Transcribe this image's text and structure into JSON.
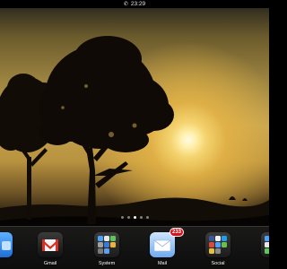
{
  "status_bar": {
    "time": "23:29",
    "call_icon": "phone-icon"
  },
  "page_indicator": {
    "count": 5,
    "active_index": 2
  },
  "dock": {
    "apps": [
      {
        "name": "",
        "icon": "app-icon"
      },
      {
        "name": "Gmail",
        "icon": "gmail-icon"
      },
      {
        "name": "System",
        "icon": "folder-icon"
      },
      {
        "name": "Mail",
        "icon": "mail-icon",
        "badge": "233"
      },
      {
        "name": "Social",
        "icon": "folder-icon"
      },
      {
        "name": "",
        "icon": "folder-icon"
      }
    ]
  },
  "wallpaper": {
    "sun_color": "#fff6cc",
    "sky_color": "#c3a452"
  }
}
